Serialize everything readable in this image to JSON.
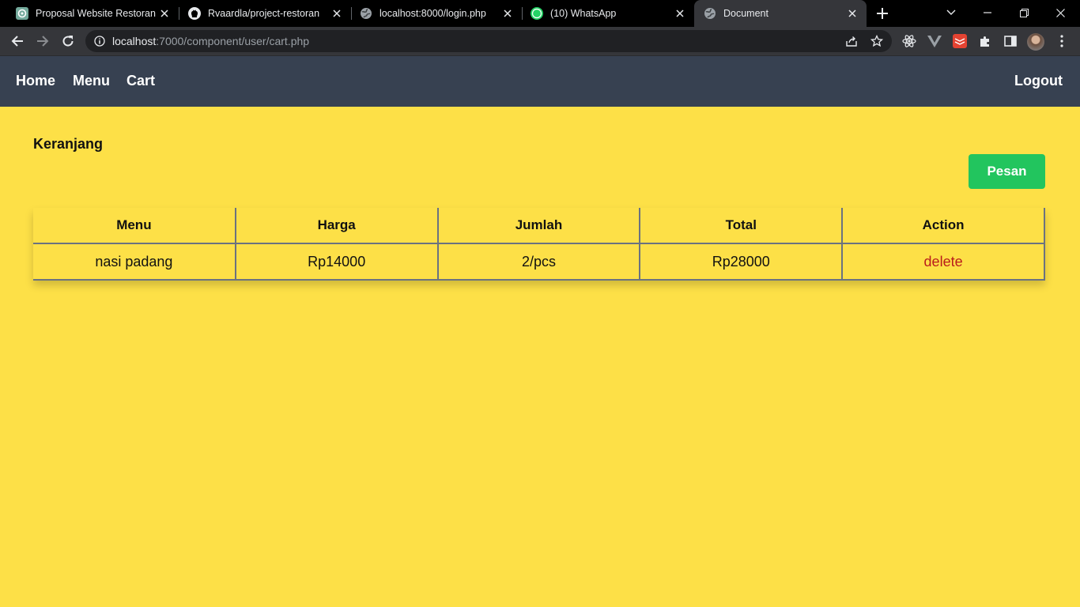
{
  "browser": {
    "tabs": [
      {
        "title": "Proposal Website Restoran",
        "icon": "chatgpt-icon",
        "active": false
      },
      {
        "title": "Rvaardla/project-restoran",
        "icon": "github-icon",
        "active": false
      },
      {
        "title": "localhost:8000/login.php",
        "icon": "globe-icon",
        "active": false
      },
      {
        "title": "(10) WhatsApp",
        "icon": "whatsapp-icon",
        "active": false,
        "badge": "10"
      },
      {
        "title": "Document",
        "icon": "globe-icon",
        "active": true
      }
    ],
    "url": {
      "host": "localhost",
      "rest": ":7000/component/user/cart.php"
    }
  },
  "nav": {
    "links": [
      "Home",
      "Menu",
      "Cart"
    ],
    "logout": "Logout"
  },
  "cart": {
    "title": "Keranjang",
    "order_button": "Pesan",
    "columns": [
      "Menu",
      "Harga",
      "Jumlah",
      "Total",
      "Action"
    ],
    "rows": [
      {
        "menu": "nasi padang",
        "harga": "Rp14000",
        "jumlah": "2/pcs",
        "total": "Rp28000",
        "action": "delete"
      }
    ]
  },
  "colors": {
    "page_bg": "#fde047",
    "navbar_bg": "#374151",
    "order_button": "#22c55e",
    "delete_link": "#b91c1c"
  }
}
